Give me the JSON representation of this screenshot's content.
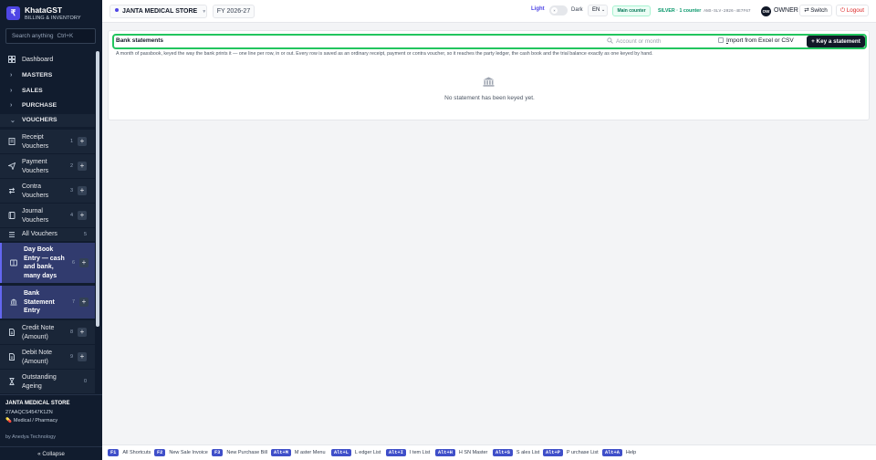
{
  "brand": {
    "logo_glyph": "₹",
    "name": "KhataGST",
    "subtitle": "BILLING & INVENTORY"
  },
  "search": {
    "placeholder": "Search anything",
    "shortcut": "Ctrl+K"
  },
  "nav": {
    "dashboard": "Dashboard",
    "sections": {
      "masters": "MASTERS",
      "sales": "SALES",
      "purchase": "PURCHASE",
      "vouchers": "VOUCHERS"
    },
    "vouchers_items": [
      {
        "label_lines": [
          "Receipt",
          "Vouchers"
        ],
        "num": "1",
        "has_add": true,
        "icon": "receipt-icon"
      },
      {
        "label_lines": [
          "Payment",
          "Vouchers"
        ],
        "num": "2",
        "has_add": true,
        "icon": "send-icon"
      },
      {
        "label_lines": [
          "Contra",
          "Vouchers"
        ],
        "num": "3",
        "has_add": true,
        "icon": "swap-icon"
      },
      {
        "label_lines": [
          "Journal",
          "Vouchers"
        ],
        "num": "4",
        "has_add": true,
        "icon": "book-icon"
      },
      {
        "label_lines": [
          "All Vouchers"
        ],
        "num": "5",
        "has_add": false,
        "icon": "list-icon"
      },
      {
        "label_lines": [
          "Day Book",
          "Entry — cash",
          "and bank,",
          "many days"
        ],
        "num": "6",
        "has_add": true,
        "icon": "daybook-icon"
      },
      {
        "label_lines": [
          "Bank",
          "Statement",
          "Entry"
        ],
        "num": "7",
        "has_add": true,
        "icon": "bank-icon"
      },
      {
        "label_lines": [
          "Credit Note",
          "(Amount)"
        ],
        "num": "8",
        "has_add": true,
        "icon": "document-icon"
      },
      {
        "label_lines": [
          "Debit Note",
          "(Amount)"
        ],
        "num": "9",
        "has_add": true,
        "icon": "document-icon"
      },
      {
        "label_lines": [
          "Outstanding",
          "Ageing"
        ],
        "num": "0",
        "has_add": false,
        "icon": "hourglass-icon"
      }
    ],
    "add_glyph": "+"
  },
  "store": {
    "name": "JANTA MEDICAL STORE",
    "gstin": "27AAQCS4547K1ZN",
    "type": "Medical / Pharmacy"
  },
  "credit": "by Anedya Technology",
  "collapse_label": "« Collapse",
  "topbar": {
    "store_name": "JANTA MEDICAL STORE",
    "fy": "FY 2026-27",
    "theme_light": "Light",
    "theme_dark": "Dark",
    "language": "EN",
    "counter": "Main counter",
    "plan": "SILVER · 1 counter",
    "plan_code": "ANS-SLV-2026-4E7F67",
    "avatar_initials": "OW",
    "role": "OWNER",
    "switch_label": "⇄ Switch",
    "logout_label": "⏻ Logout"
  },
  "page": {
    "title": "Bank statements",
    "account_search_placeholder": "Account or month",
    "import_label_u": "I",
    "import_label_rest": "mport from Excel or CSV",
    "key_button": "+ Key a statement",
    "description": "A month of passbook, keyed the way the bank prints it — one line per row, in or out. Every row is saved as an ordinary receipt, payment or contra voucher, so it reaches the party ledger, the cash book and the trial balance exactly as one keyed by hand.",
    "empty_state": "No statement has been keyed yet."
  },
  "shortcuts": [
    {
      "key": "F1",
      "label": "All Shortcuts"
    },
    {
      "key": "F2",
      "label": "New Sale Invoice"
    },
    {
      "key": "F3",
      "label": "New Purchase Bill"
    },
    {
      "key": "Alt+M",
      "label": "M aster Menu"
    },
    {
      "key": "Alt+L",
      "label": "L edger List"
    },
    {
      "key": "Alt+I",
      "label": "I tem List"
    },
    {
      "key": "Alt+H",
      "label": "H SN Master"
    },
    {
      "key": "Alt+S",
      "label": "S ales List"
    },
    {
      "key": "Alt+P",
      "label": "P urchase List"
    },
    {
      "key": "Alt+A",
      "label": "Help"
    }
  ],
  "colors": {
    "sidebar_bg": "#111c2e",
    "accent": "#4f46e5",
    "highlight_border": "#22c55e",
    "logout": "#dc2626",
    "plan": "#059669"
  }
}
